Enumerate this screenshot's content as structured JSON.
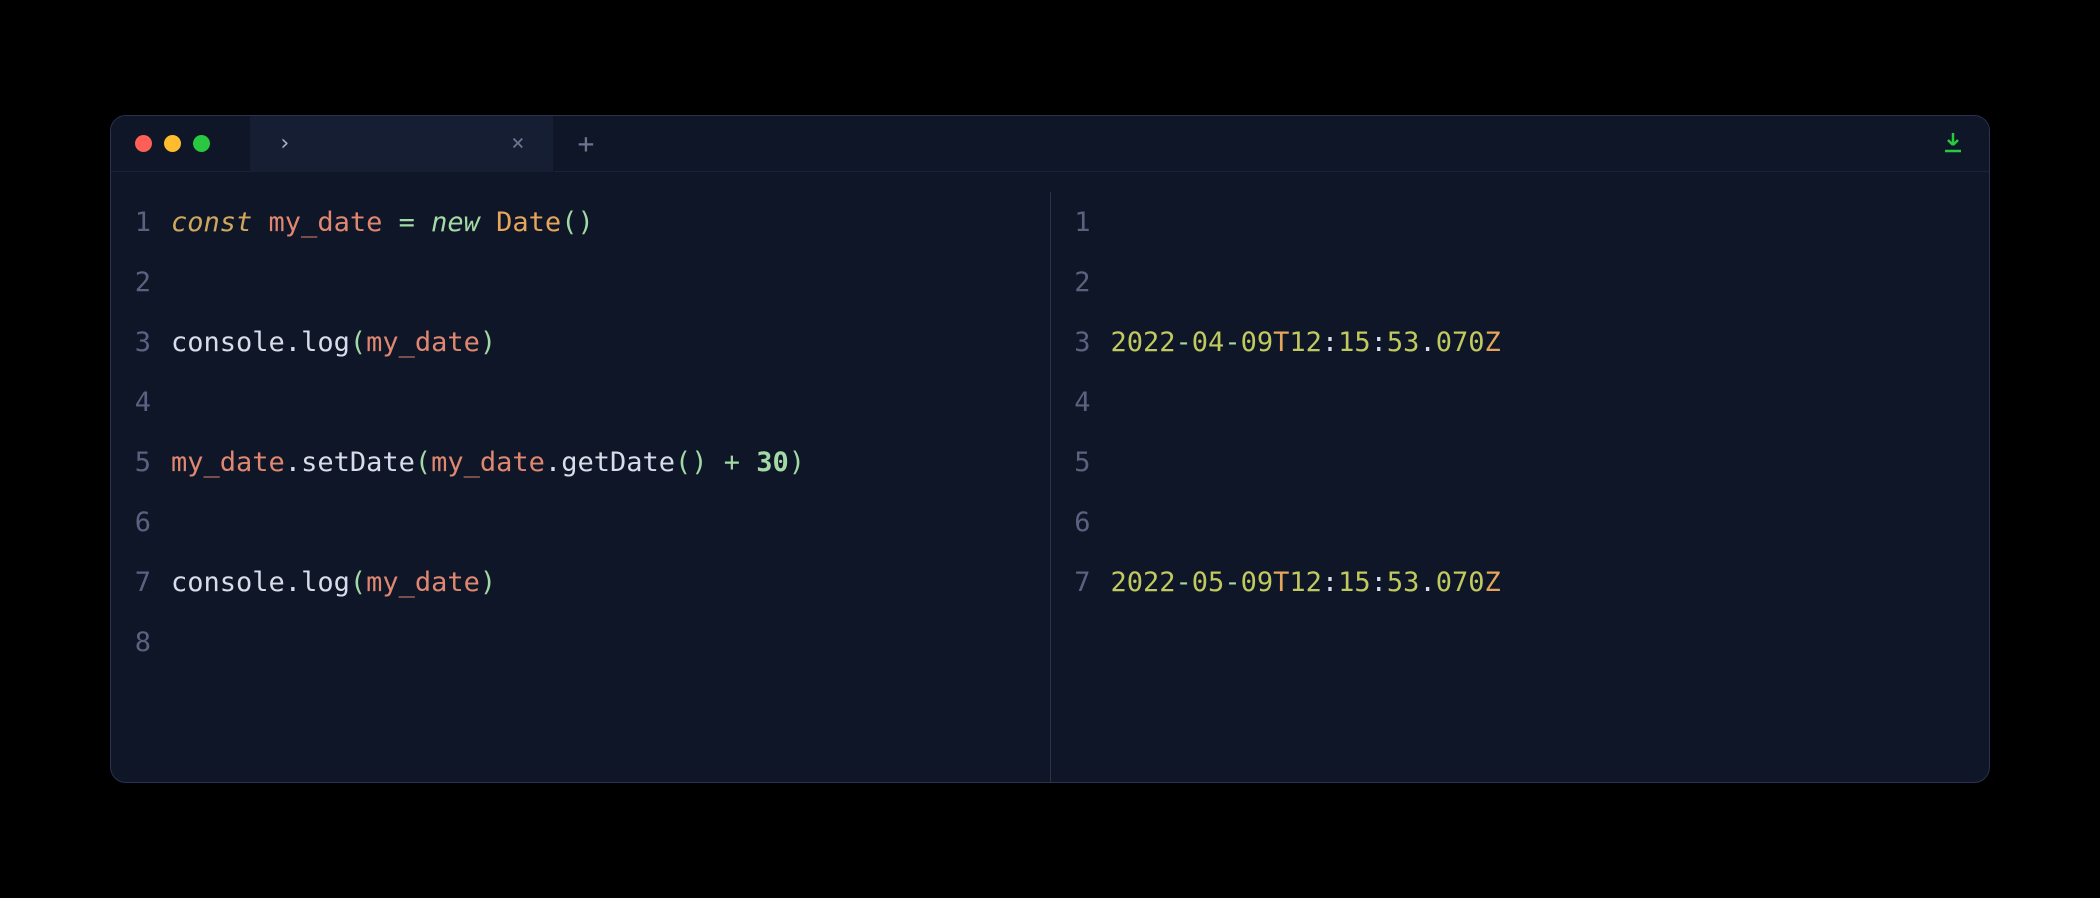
{
  "titlebar": {
    "tab_title": "›",
    "close_glyph": "×",
    "new_tab_glyph": "+"
  },
  "code": {
    "lines": [
      {
        "n": "1",
        "tokens": [
          {
            "t": "const ",
            "c": "tok-keyword"
          },
          {
            "t": "my_date",
            "c": "tok-var"
          },
          {
            "t": " = ",
            "c": "tok-op"
          },
          {
            "t": "new ",
            "c": "tok-new"
          },
          {
            "t": "Date",
            "c": "tok-class"
          },
          {
            "t": "()",
            "c": "tok-punct"
          }
        ]
      },
      {
        "n": "2",
        "tokens": []
      },
      {
        "n": "3",
        "tokens": [
          {
            "t": "console",
            "c": "tok-obj"
          },
          {
            "t": ".",
            "c": "tok-obj"
          },
          {
            "t": "log",
            "c": "tok-method"
          },
          {
            "t": "(",
            "c": "tok-punct"
          },
          {
            "t": "my_date",
            "c": "tok-var"
          },
          {
            "t": ")",
            "c": "tok-punct"
          }
        ]
      },
      {
        "n": "4",
        "tokens": []
      },
      {
        "n": "5",
        "tokens": [
          {
            "t": "my_date",
            "c": "tok-var"
          },
          {
            "t": ".",
            "c": "tok-obj"
          },
          {
            "t": "setDate",
            "c": "tok-method"
          },
          {
            "t": "(",
            "c": "tok-punct"
          },
          {
            "t": "my_date",
            "c": "tok-var"
          },
          {
            "t": ".",
            "c": "tok-obj"
          },
          {
            "t": "getDate",
            "c": "tok-method"
          },
          {
            "t": "()",
            "c": "tok-punct"
          },
          {
            "t": " + ",
            "c": "tok-op"
          },
          {
            "t": "30",
            "c": "tok-num"
          },
          {
            "t": ")",
            "c": "tok-punct"
          }
        ]
      },
      {
        "n": "6",
        "tokens": []
      },
      {
        "n": "7",
        "tokens": [
          {
            "t": "console",
            "c": "tok-obj"
          },
          {
            "t": ".",
            "c": "tok-obj"
          },
          {
            "t": "log",
            "c": "tok-method"
          },
          {
            "t": "(",
            "c": "tok-punct"
          },
          {
            "t": "my_date",
            "c": "tok-var"
          },
          {
            "t": ")",
            "c": "tok-punct"
          }
        ]
      },
      {
        "n": "8",
        "tokens": []
      }
    ]
  },
  "output": {
    "lines": [
      {
        "n": "1",
        "tokens": []
      },
      {
        "n": "2",
        "tokens": []
      },
      {
        "n": "3",
        "tokens": [
          {
            "t": "2022",
            "c": "out-num"
          },
          {
            "t": "-",
            "c": "out-dash"
          },
          {
            "t": "04",
            "c": "out-num"
          },
          {
            "t": "-",
            "c": "out-dash"
          },
          {
            "t": "09",
            "c": "out-num"
          },
          {
            "t": "T",
            "c": "out-t"
          },
          {
            "t": "12",
            "c": "out-num"
          },
          {
            "t": ":",
            "c": "out-colon"
          },
          {
            "t": "15",
            "c": "out-num"
          },
          {
            "t": ":",
            "c": "out-colon"
          },
          {
            "t": "53",
            "c": "out-num"
          },
          {
            "t": ".",
            "c": "out-dot"
          },
          {
            "t": "070",
            "c": "out-num"
          },
          {
            "t": "Z",
            "c": "out-z"
          }
        ]
      },
      {
        "n": "4",
        "tokens": []
      },
      {
        "n": "5",
        "tokens": []
      },
      {
        "n": "6",
        "tokens": []
      },
      {
        "n": "7",
        "tokens": [
          {
            "t": "2022",
            "c": "out-num"
          },
          {
            "t": "-",
            "c": "out-dash"
          },
          {
            "t": "05",
            "c": "out-num"
          },
          {
            "t": "-",
            "c": "out-dash"
          },
          {
            "t": "09",
            "c": "out-num"
          },
          {
            "t": "T",
            "c": "out-t"
          },
          {
            "t": "12",
            "c": "out-num"
          },
          {
            "t": ":",
            "c": "out-colon"
          },
          {
            "t": "15",
            "c": "out-num"
          },
          {
            "t": ":",
            "c": "out-colon"
          },
          {
            "t": "53",
            "c": "out-num"
          },
          {
            "t": ".",
            "c": "out-dot"
          },
          {
            "t": "070",
            "c": "out-num"
          },
          {
            "t": "Z",
            "c": "out-z"
          }
        ]
      }
    ]
  }
}
